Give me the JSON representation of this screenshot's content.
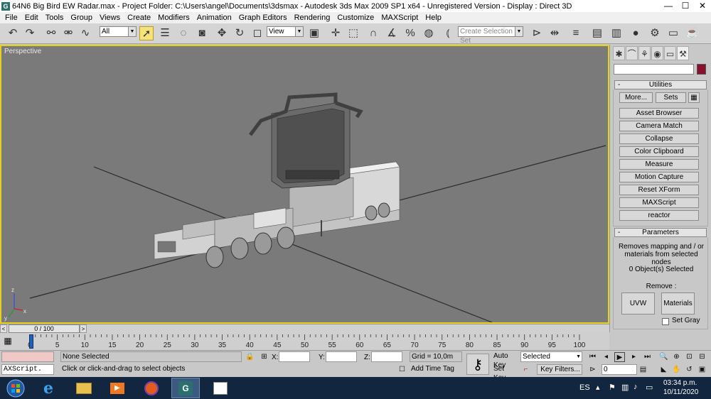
{
  "window": {
    "title": "64N6 Big Bird EW Radar.max    - Project Folder: C:\\Users\\angel\\Documents\\3dsmax      - Autodesk 3ds Max  2009 SP1  x64  - Unregistered Version       - Display : Direct 3D",
    "minimize": "—",
    "maximize": "☐",
    "close": "✕"
  },
  "menu": [
    "File",
    "Edit",
    "Tools",
    "Group",
    "Views",
    "Create",
    "Modifiers",
    "Animation",
    "Graph Editors",
    "Rendering",
    "Customize",
    "MAXScript",
    "Help"
  ],
  "toolbar": {
    "selection_filter": "All",
    "reference_coord": "View",
    "named_selection_placeholder": "Create Selection Set"
  },
  "viewport": {
    "label": "Perspective",
    "axis_x": "x",
    "axis_y": "y",
    "axis_z": "z"
  },
  "command_panel": {
    "utilities_header": "Utilities",
    "more_button": "More...",
    "sets_button": "Sets",
    "utilities": [
      "Asset Browser",
      "Camera Match",
      "Collapse",
      "Color Clipboard",
      "Measure",
      "Motion Capture",
      "Reset XForm",
      "MAXScript",
      "reactor"
    ],
    "parameters_header": "Parameters",
    "param_description": "Removes mapping and / or materials from selected nodes",
    "selected_count": "0 Object(s) Selected",
    "remove_label": "Remove :",
    "uvw_button": "UVW",
    "materials_button": "Materials",
    "set_gray_label": "Set Gray",
    "collapse_symbol": "-"
  },
  "timeline": {
    "slider_text": "0 / 100",
    "prev_arrow": "<",
    "next_arrow": ">",
    "ticks": [
      "0",
      "5",
      "10",
      "15",
      "20",
      "25",
      "30",
      "35",
      "40",
      "45",
      "50",
      "55",
      "60",
      "65",
      "70",
      "75",
      "80",
      "85",
      "90",
      "95",
      "100"
    ],
    "current_frame": 0
  },
  "status": {
    "listener_prompt": "AXScript.",
    "selection_text": "None Selected",
    "prompt_text": "Click or click-and-drag to select objects",
    "x_label": "X:",
    "y_label": "Y:",
    "z_label": "Z:",
    "x_value": "",
    "y_value": "",
    "z_value": "",
    "grid": "Grid = 10,0m",
    "add_time_tag": "Add Time Tag",
    "auto_key": "Auto Key",
    "set_key": "Set Key",
    "key_mode": "Selected",
    "key_filters": "Key Filters...",
    "current_frame_field": "0"
  },
  "taskbar": {
    "language": "ES",
    "time": "03:34 p.m.",
    "date": "10/11/2020"
  },
  "colors": {
    "viewport_bg": "#7a7a7a",
    "viewport_border": "#e6d21a",
    "object_color": "#8a1030"
  }
}
